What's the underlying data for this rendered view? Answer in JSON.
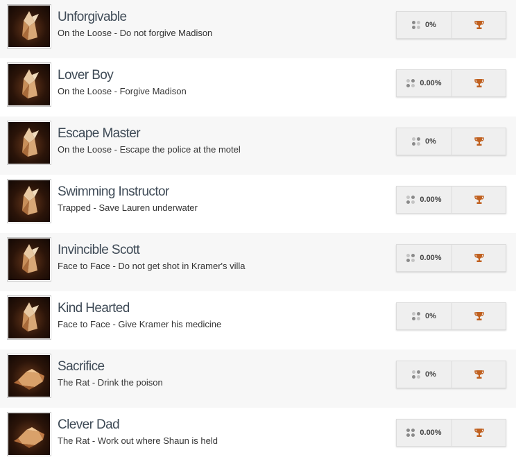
{
  "accent": {
    "trophy": "#c0601f",
    "title": "#3e4a56"
  },
  "achievements": [
    {
      "title": "Unforgivable",
      "description": "On the Loose - Do not forgive Madison",
      "percent": "0%",
      "icon": "origami-figure-icon",
      "trophy": "bronze-trophy-icon"
    },
    {
      "title": "Lover Boy",
      "description": "On the Loose - Forgive Madison",
      "percent": "0.00%",
      "icon": "origami-figure-icon",
      "trophy": "bronze-trophy-icon"
    },
    {
      "title": "Escape Master",
      "description": "On the Loose - Escape the police at the motel",
      "percent": "0%",
      "icon": "origami-figure-icon",
      "trophy": "bronze-trophy-icon"
    },
    {
      "title": "Swimming Instructor",
      "description": "Trapped - Save Lauren underwater",
      "percent": "0.00%",
      "icon": "origami-figure-icon",
      "trophy": "bronze-trophy-icon"
    },
    {
      "title": "Invincible Scott",
      "description": "Face to Face - Do not get shot in Kramer's villa",
      "percent": "0.00%",
      "icon": "origami-figure-icon",
      "trophy": "bronze-trophy-icon"
    },
    {
      "title": "Kind Hearted",
      "description": "Face to Face - Give Kramer his medicine",
      "percent": "0%",
      "icon": "origami-figure-icon",
      "trophy": "bronze-trophy-icon"
    },
    {
      "title": "Sacrifice",
      "description": "The Rat - Drink the poison",
      "percent": "0%",
      "icon": "origami-rat-icon",
      "trophy": "bronze-trophy-icon"
    },
    {
      "title": "Clever Dad",
      "description": "The Rat - Work out where Shaun is held",
      "percent": "0.00%",
      "icon": "origami-rat-icon",
      "trophy": "bronze-trophy-icon"
    }
  ]
}
